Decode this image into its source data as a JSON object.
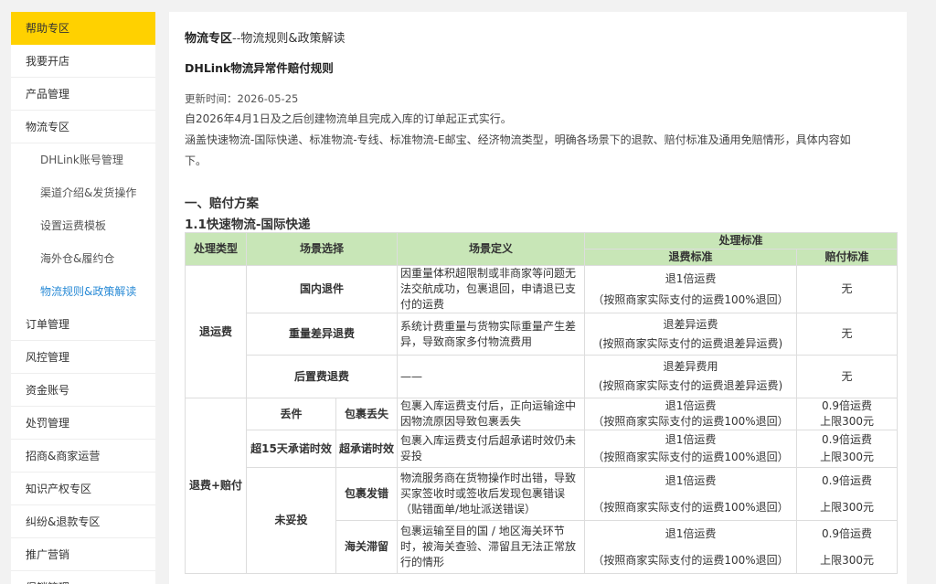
{
  "sidebar": {
    "items": [
      {
        "label": "帮助专区"
      },
      {
        "label": "我要开店"
      },
      {
        "label": "产品管理"
      },
      {
        "label": "物流专区"
      },
      {
        "label": "DHLink账号管理"
      },
      {
        "label": "渠道介绍&发货操作"
      },
      {
        "label": "设置运费模板"
      },
      {
        "label": "海外仓&履约仓"
      },
      {
        "label": "物流规则&政策解读"
      },
      {
        "label": "订单管理"
      },
      {
        "label": "风控管理"
      },
      {
        "label": "资金账号"
      },
      {
        "label": "处罚管理"
      },
      {
        "label": "招商&商家运营"
      },
      {
        "label": "知识产权专区"
      },
      {
        "label": "纠纷&退款专区"
      },
      {
        "label": "推广营销"
      },
      {
        "label": "促销管理"
      }
    ]
  },
  "breadcrumb": {
    "section": "物流专区",
    "separator": "--",
    "page": "物流规则&政策解读"
  },
  "doc": {
    "title": "DHLink物流异常件赔付规则",
    "updated": "更新时间：2026-05-25",
    "para1": "自2026年4月1日及之后创建物流单且完成入库的订单起正式实行。",
    "para2_line1": "涵盖快速物流-国际快递、标准物流-专线、标准物流-E邮宝、经济物流类型，明确各场景下的退款、赔付标准及通用免赔情形，具体内容如",
    "para2_line2": "下。",
    "section1": "一、赔付方案",
    "section1_1": "1.1快速物流-国际快递"
  },
  "table": {
    "headers": {
      "type": "处理类型",
      "scene": "场景选择",
      "definition": "场景定义",
      "standard": "处理标准",
      "refund_std": "退费标准",
      "comp_std": "赔付标准"
    },
    "group1": {
      "type": "退运费",
      "rows": [
        {
          "scene": "国内退件",
          "definition": "因重量体积超限制或非商家等问题无法交航成功，包裹退回，申请退已支付的运费",
          "refund_a": "退1倍运费",
          "refund_b": "（按照商家实际支付的运费100%退回）",
          "comp": "无"
        },
        {
          "scene": "重量差异退费",
          "definition": "系统计费重量与货物实际重量产生差异，导致商家多付物流费用",
          "refund_a": "退差异运费",
          "refund_b": "(按照商家实际支付的运费退差异运费)",
          "comp": "无"
        },
        {
          "scene": "后置费退费",
          "definition": "——",
          "refund_a": "退差异费用",
          "refund_b": "(按照商家实际支付的运费退差异运费)",
          "comp": "无"
        }
      ]
    },
    "group2": {
      "type": "退费+赔付",
      "rows": [
        {
          "scene": "丢件",
          "sub": "包裹丢失",
          "definition": "包裹入库运费支付后，正向运输途中因物流原因导致包裹丢失",
          "refund_a": "退1倍运费",
          "refund_b": "（按照商家实际支付的运费100%退回）",
          "comp_a": "0.9倍运费",
          "comp_b": "上限300元"
        },
        {
          "scene": "超15天承诺时效",
          "sub": "超承诺时效",
          "definition": "包裹入库运费支付后超承诺时效仍未妥投",
          "refund_a": "退1倍运费",
          "refund_b": "（按照商家实际支付的运费100%退回）",
          "comp_a": "0.9倍运费",
          "comp_b": "上限300元"
        },
        {
          "scene": "未妥投",
          "sub": "包裹发错",
          "definition": "物流服务商在货物操作时出错，导致买家签收时或签收后发现包裹错误（贴错面单/地址派送错误）",
          "refund_a": "退1倍运费",
          "refund_b": "（按照商家实际支付的运费100%退回）",
          "comp_a": "0.9倍运费",
          "comp_b": "上限300元"
        },
        {
          "sub": "海关滞留",
          "definition": "包裹运输至目的国 / 地区海关环节时，被海关查验、滞留且无法正常放行的情形",
          "refund_a": "退1倍运费",
          "refund_b": "（按照商家实际支付的运费100%退回）",
          "comp_a": "0.9倍运费",
          "comp_b": "上限300元"
        }
      ]
    }
  },
  "colors": {
    "accent": "#ffd100",
    "link": "#2a8bd6",
    "table_header": "#c8e6b7"
  }
}
